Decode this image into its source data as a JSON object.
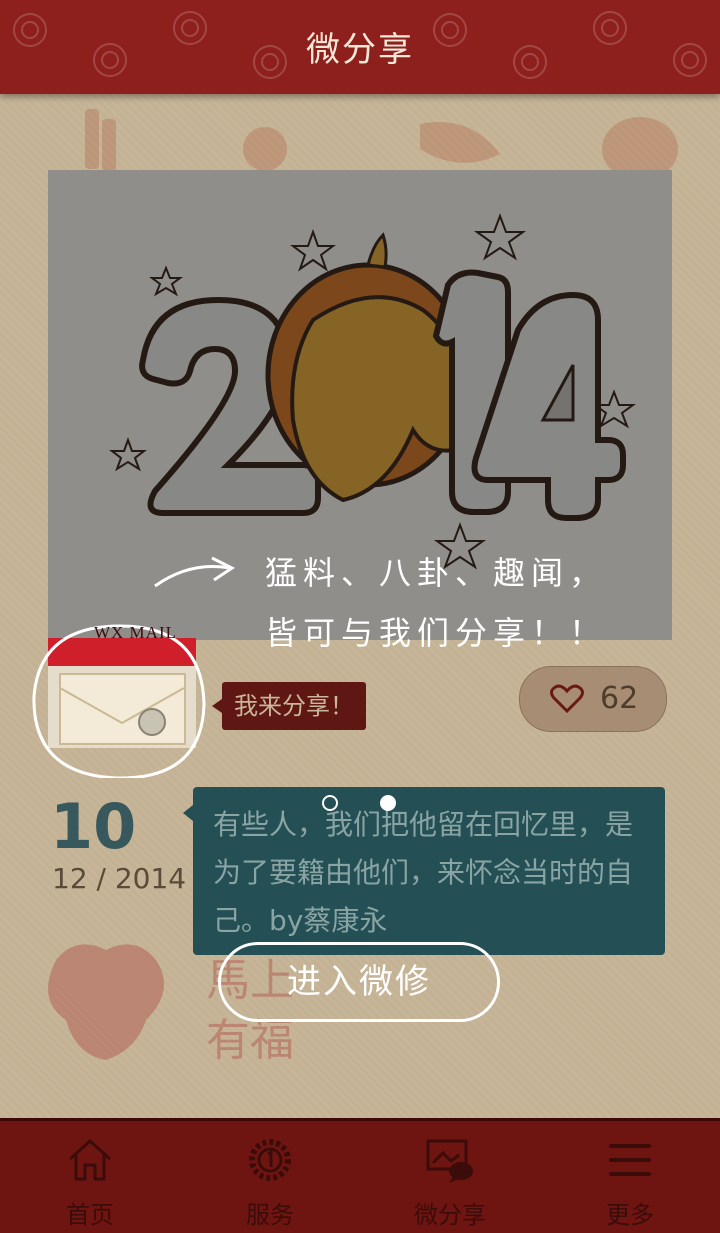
{
  "header": {
    "title": "微分享"
  },
  "banner": {
    "year_art": "2014",
    "share_line1": "猛料、八卦、趣闻，",
    "share_line2": "皆可与我们分享！！"
  },
  "mail": {
    "label": "WX MAIL"
  },
  "share_button": {
    "label": "我来分享！"
  },
  "like": {
    "count": "62"
  },
  "date": {
    "day": "10",
    "month_year": "12 / 2014"
  },
  "quote": {
    "text": "有些人，我们把他留在回忆里，是为了要籍由他们，来怀念当时的自己。by蔡康永"
  },
  "carousel": {
    "total": 2,
    "active": 2
  },
  "enter_button": {
    "label": "进入微修"
  },
  "background_art": {
    "line1": "馬上",
    "line2": "有福"
  },
  "tabs": [
    {
      "label": "首页",
      "icon": "home-icon"
    },
    {
      "label": "服务",
      "icon": "service-icon"
    },
    {
      "label": "微分享",
      "icon": "microshare-icon"
    },
    {
      "label": "更多",
      "icon": "menu-icon"
    }
  ],
  "colors": {
    "header": "#8d1f1c",
    "tabbar": "#6e1512",
    "quote_bg": "#234f55",
    "date_day": "#37585c"
  }
}
